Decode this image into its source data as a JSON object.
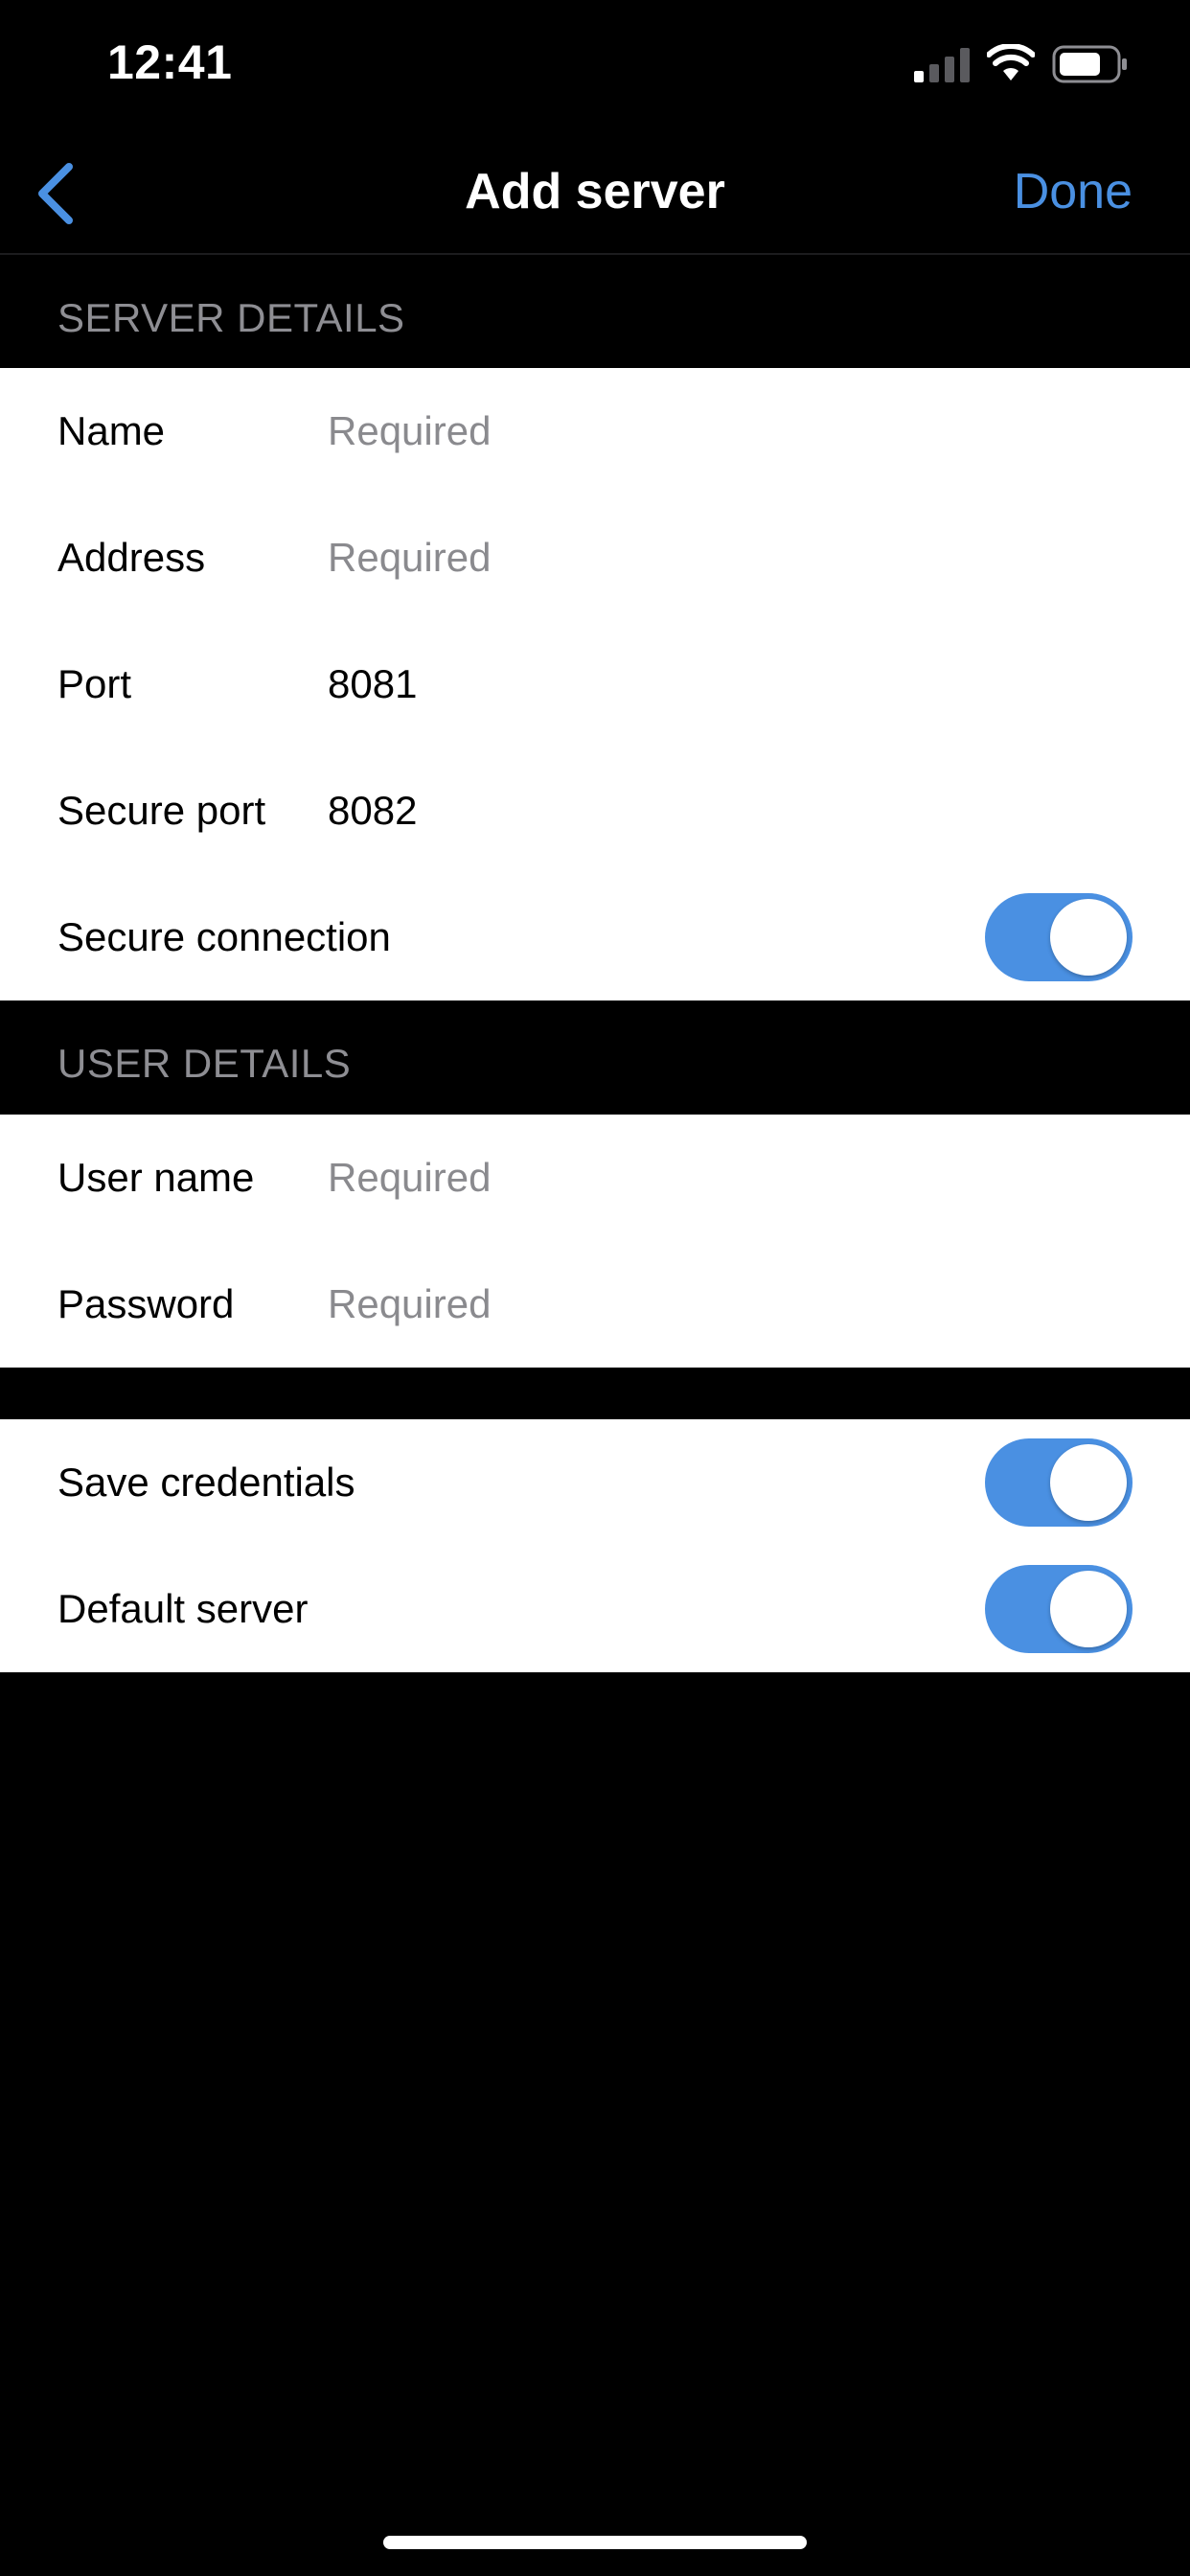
{
  "status_bar": {
    "time": "12:41"
  },
  "nav": {
    "title": "Add server",
    "done_label": "Done",
    "accent_color": "#4a90e2"
  },
  "server_details": {
    "header": "SERVER DETAILS",
    "name": {
      "label": "Name",
      "value": "",
      "placeholder": "Required"
    },
    "address": {
      "label": "Address",
      "value": "",
      "placeholder": "Required"
    },
    "port": {
      "label": "Port",
      "value": "8081"
    },
    "secure_port": {
      "label": "Secure port",
      "value": "8082"
    },
    "secure_connection": {
      "label": "Secure connection",
      "on": true
    }
  },
  "user_details": {
    "header": "USER DETAILS",
    "user_name": {
      "label": "User name",
      "value": "",
      "placeholder": "Required"
    },
    "password": {
      "label": "Password",
      "value": "",
      "placeholder": "Required"
    }
  },
  "options": {
    "save_credentials": {
      "label": "Save credentials",
      "on": true
    },
    "default_server": {
      "label": "Default server",
      "on": true
    }
  },
  "icons": [
    "signal-icon",
    "wifi-icon",
    "battery-icon",
    "chevron-left-icon"
  ]
}
